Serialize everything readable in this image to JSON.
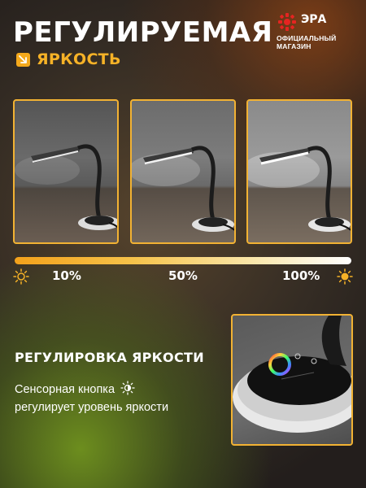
{
  "header": {
    "title": "РЕГУЛИРУЕМАЯ",
    "subtitle": "ЯРКОСТЬ",
    "subtitle_icon": "diagonal-arrow-icon"
  },
  "brand": {
    "name": "ЭРА",
    "tagline_line1": "ОФИЦИАЛЬНЫЙ",
    "tagline_line2": "МАГАЗИН",
    "color": "#e52421"
  },
  "photos": [
    {
      "name": "lamp-photo-low"
    },
    {
      "name": "lamp-photo-mid"
    },
    {
      "name": "lamp-photo-high"
    }
  ],
  "brightness": {
    "levels": [
      "10%",
      "50%",
      "100%"
    ],
    "left_icon": "sun-outline-icon",
    "right_icon": "sun-filled-icon"
  },
  "section": {
    "title": "РЕГУЛИРОВКА ЯРКОСТИ",
    "description_line1": "Сенсорная кнопка",
    "description_line2": "регулирует уровень яркости",
    "description_icon": "brightness-touch-icon"
  },
  "colors": {
    "accent": "#f2b233",
    "subtitle": "#f6b227"
  }
}
